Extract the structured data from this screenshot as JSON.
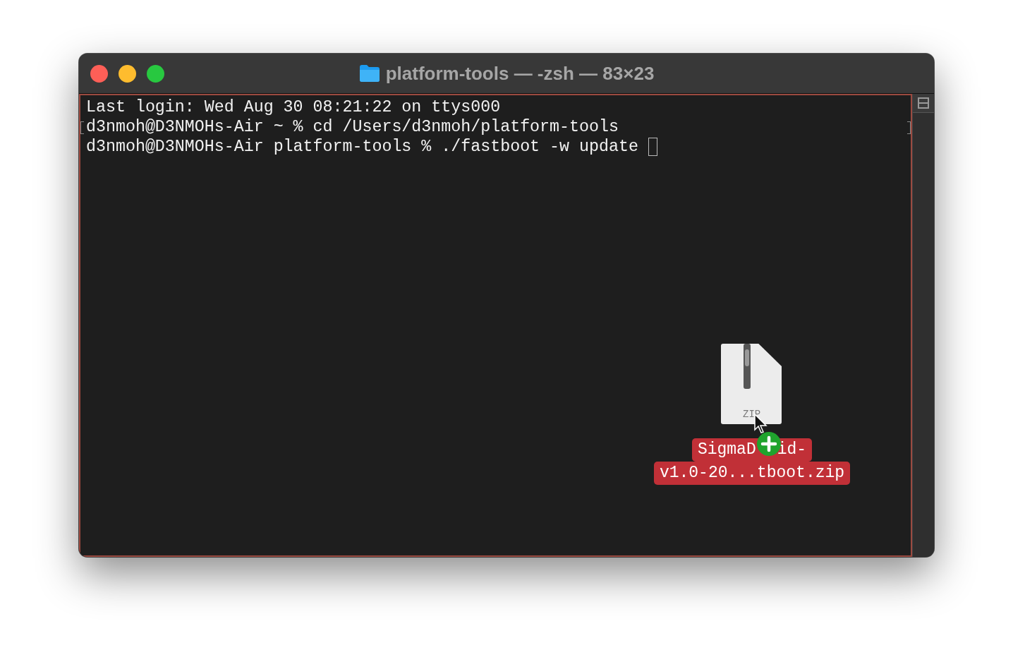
{
  "window": {
    "title": "platform-tools — -zsh — 83×23"
  },
  "terminal": {
    "lines": [
      {
        "text": "Last login: Wed Aug 30 08:21:22 on ttys000",
        "marked": false,
        "cursor": false
      },
      {
        "text": "d3nmoh@D3NMOHs-Air ~ % cd /Users/d3nmoh/platform-tools",
        "marked": true,
        "cursor": false
      },
      {
        "text": "d3nmoh@D3NMOHs-Air platform-tools % ./fastboot -w update",
        "marked": false,
        "cursor": true
      }
    ],
    "drop_target": true
  },
  "dragged_file": {
    "icon_label": "ZIP",
    "name_line_1": [
      "SigmaD",
      "id-"
    ],
    "name_line_2": "v1.0-20...tboot.zip"
  }
}
